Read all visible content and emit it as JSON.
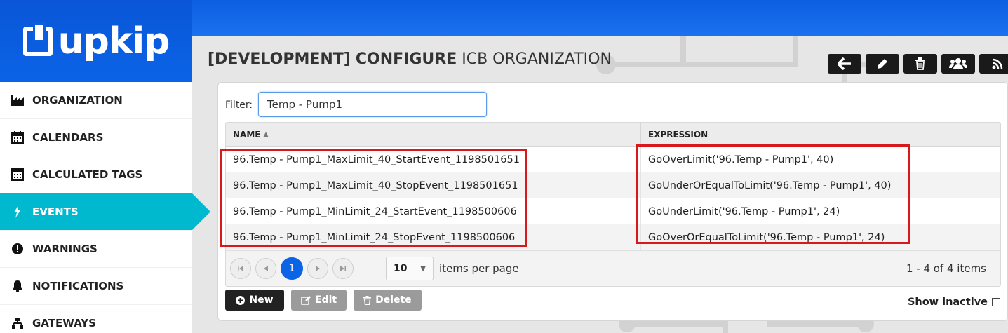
{
  "brand": {
    "logo_text": "upkip"
  },
  "sidebar": {
    "items": [
      {
        "label": "ORGANIZATION",
        "icon": "factory-icon"
      },
      {
        "label": "CALENDARS",
        "icon": "calendar-icon"
      },
      {
        "label": "CALCULATED TAGS",
        "icon": "calculator-icon"
      },
      {
        "label": "EVENTS",
        "icon": "bolt-icon",
        "active": true
      },
      {
        "label": "WARNINGS",
        "icon": "exclamation-icon"
      },
      {
        "label": "NOTIFICATIONS",
        "icon": "bell-icon"
      },
      {
        "label": "GATEWAYS",
        "icon": "sitemap-icon"
      }
    ]
  },
  "header": {
    "title_env": "[DEVELOPMENT]",
    "title_action": "CONFIGURE",
    "title_org": "ICB ORGANIZATION"
  },
  "toolbar": {
    "buttons": [
      "back-arrow-icon",
      "pencil-icon",
      "trash-icon",
      "users-icon",
      "rss-icon"
    ]
  },
  "filter": {
    "label": "Filter:",
    "value": "Temp - Pump1"
  },
  "grid": {
    "columns": {
      "name": "NAME",
      "sort_indicator": "▲",
      "expression": "EXPRESSION"
    },
    "rows": [
      {
        "name": "96.Temp - Pump1_MaxLimit_40_StartEvent_1198501651",
        "expression": "GoOverLimit('96.Temp - Pump1', 40)"
      },
      {
        "name": "96.Temp - Pump1_MaxLimit_40_StopEvent_1198501651",
        "expression": "GoUnderOrEqualToLimit('96.Temp - Pump1', 40)"
      },
      {
        "name": "96.Temp - Pump1_MinLimit_24_StartEvent_1198500606",
        "expression": "GoUnderLimit('96.Temp - Pump1', 24)"
      },
      {
        "name": "96.Temp - Pump1_MinLimit_24_StopEvent_1198500606",
        "expression": "GoOverOrEqualToLimit('96.Temp - Pump1', 24)"
      }
    ]
  },
  "pager": {
    "current_page": "1",
    "page_size": "10",
    "page_size_label": "items per page",
    "info": "1 - 4 of 4 items"
  },
  "actions": {
    "new": "New",
    "edit": "Edit",
    "delete": "Delete"
  },
  "show_inactive": {
    "label": "Show inactive",
    "checked": false
  },
  "colors": {
    "primary_blue": "#0b5fe0",
    "active_teal": "#00b9cf",
    "highlight_red": "#d7191c"
  }
}
